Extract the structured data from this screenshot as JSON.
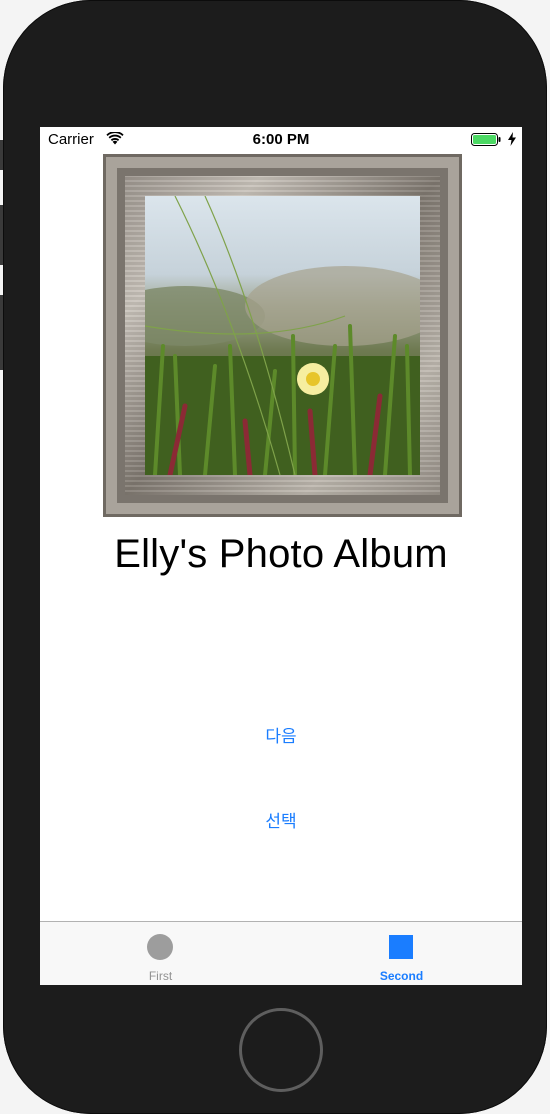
{
  "status_bar": {
    "carrier": "Carrier",
    "time": "6:00 PM",
    "wifi_icon": "wifi-icon",
    "battery_icon": "battery-icon",
    "charging_icon": "bolt-icon"
  },
  "header_image": {
    "icon": "framed-photo-image"
  },
  "title": "Elly's Photo Album",
  "buttons": {
    "next_label": "다음",
    "select_label": "선택"
  },
  "tabs": [
    {
      "label": "First",
      "icon": "circle-icon",
      "selected": false
    },
    {
      "label": "Second",
      "icon": "square-icon",
      "selected": true
    }
  ],
  "colors": {
    "accent": "#1a7dff",
    "tab_inactive": "#929292",
    "battery": "#4cd964",
    "device": "#1c1c1c"
  }
}
